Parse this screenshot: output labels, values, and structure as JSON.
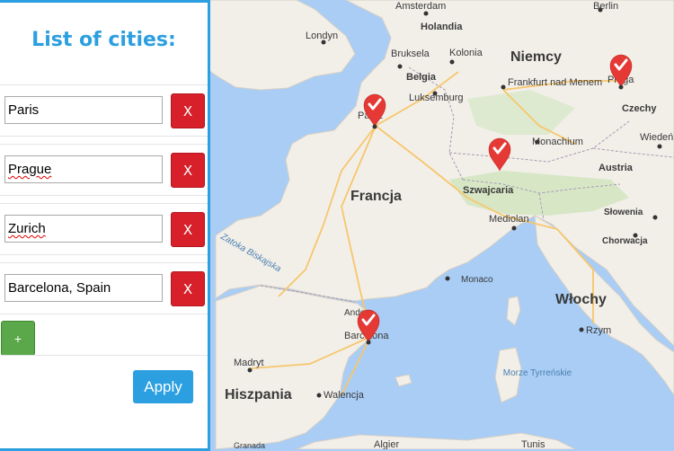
{
  "panel": {
    "title": "List of cities:",
    "cities": [
      {
        "value": "Paris",
        "spellcheck_error": false,
        "remove_label": "X"
      },
      {
        "value": "Prague",
        "spellcheck_error": true,
        "remove_label": "X"
      },
      {
        "value": "Zurich",
        "spellcheck_error": true,
        "remove_label": "X"
      },
      {
        "value": "Barcelona, Spain",
        "spellcheck_error": false,
        "remove_label": "X"
      }
    ],
    "add_label": "+",
    "apply_label": "Apply"
  },
  "map": {
    "countries": [
      "Niemcy",
      "Francja",
      "Włochy",
      "Hiszpania"
    ],
    "cities": [
      "Londyn",
      "Amsterdam",
      "Holandia",
      "Bruksela",
      "Kolonia",
      "Belgia",
      "Luksemburg",
      "Frankfurt nad Menem",
      "Praga",
      "Czechy",
      "Paryż",
      "Monachium",
      "Wiedeń",
      "Austria",
      "Szwajcaria",
      "Mediolan",
      "Słowenia",
      "Chorwacja",
      "Monaco",
      "Andora",
      "Barcelona",
      "Rzym",
      "Madryt",
      "Walencja",
      "Algier",
      "Tunis",
      "Granada",
      "Berlin"
    ],
    "seas": [
      "Zatoka Biskajska",
      "Morze Tyrreńskie"
    ],
    "markers": [
      "Paris",
      "Prague",
      "Zurich",
      "Barcelona"
    ],
    "colors": {
      "water": "#a9cdf5",
      "land": "#f2efe9",
      "forest": "#cfe5bd",
      "marker": "#e53935",
      "accent": "#2b9fe0",
      "remove": "#d7202a",
      "add": "#5aa84a"
    }
  }
}
